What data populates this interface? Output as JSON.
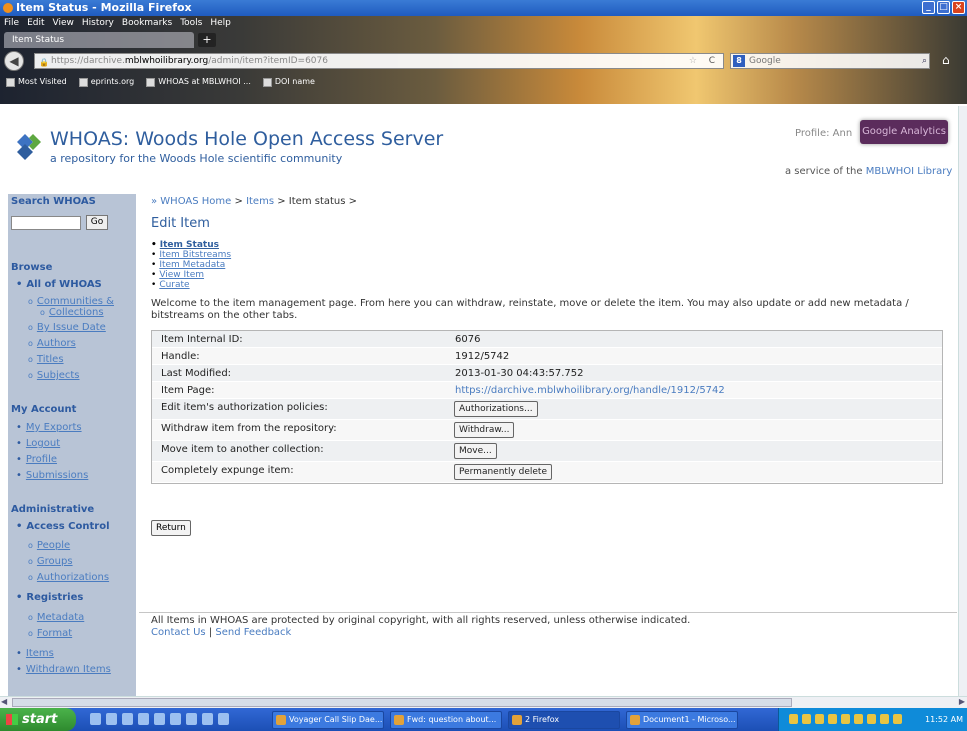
{
  "window": {
    "title": "Item Status - Mozilla Firefox"
  },
  "menubar": [
    "File",
    "Edit",
    "View",
    "History",
    "Bookmarks",
    "Tools",
    "Help"
  ],
  "browser": {
    "tab_title": "Item Status",
    "url_prefix": "https://darchive.",
    "url_host": "mblwhoilibrary.org",
    "url_path": "/admin/item?itemID=6076",
    "search_placeholder": "Google",
    "bookmarks": [
      "Most Visited",
      "eprints.org",
      "WHOAS at MBLWHOI ...",
      "DOI name"
    ]
  },
  "header": {
    "title": "WHOAS: Woods Hole Open Access Server",
    "subtitle": "a repository for the Woods Hole scientific community",
    "profile_label": "Profile: Ann",
    "analytics_button": "Google Analytics",
    "service_prefix": "a service of the ",
    "service_link": "MBLWHOI Library"
  },
  "sidebar": {
    "search_heading": "Search WHOAS",
    "go_label": "Go",
    "browse_heading": "Browse",
    "all_of": "All of WHOAS",
    "browse_items": [
      "Communities &",
      "Collections",
      "By Issue Date",
      "Authors",
      "Titles",
      "Subjects"
    ],
    "account_heading": "My Account",
    "account_items": [
      "My Exports",
      "Logout",
      "Profile",
      "Submissions"
    ],
    "admin_heading": "Administrative",
    "access_control": "Access Control",
    "access_items": [
      "People",
      "Groups",
      "Authorizations"
    ],
    "registries": "Registries",
    "registry_items": [
      "Metadata",
      "Format"
    ],
    "more_items": [
      "Items",
      "Withdrawn Items"
    ]
  },
  "main": {
    "breadcrumb_home": "WHOAS Home",
    "breadcrumb_items": "Items",
    "breadcrumb_current": "Item status",
    "heading": "Edit Item",
    "tabs": [
      "Item Status",
      "Item Bitstreams",
      "Item Metadata",
      "View Item",
      "Curate"
    ],
    "welcome": "Welcome to the item management page. From here you can withdraw, reinstate, move or delete the item. You may also update or add new metadata / bitstreams on the other tabs.",
    "rows": [
      {
        "label": "Item Internal ID:",
        "value": "6076"
      },
      {
        "label": "Handle:",
        "value": "1912/5742"
      },
      {
        "label": "Last Modified:",
        "value": "2013-01-30 04:43:57.752"
      },
      {
        "label": "Item Page:",
        "value": "https://darchive.mblwhoilibrary.org/handle/1912/5742"
      }
    ],
    "actions": [
      {
        "label": "Edit item's authorization policies:",
        "button": "Authorizations..."
      },
      {
        "label": "Withdraw item from the repository:",
        "button": "Withdraw..."
      },
      {
        "label": "Move item to another collection:",
        "button": "Move..."
      },
      {
        "label": "Completely expunge item:",
        "button": "Permanently delete"
      }
    ],
    "return_label": "Return"
  },
  "footer": {
    "notice": "All Items in WHOAS are protected by original copyright, with all rights reserved, unless otherwise indicated.",
    "contact": "Contact Us",
    "feedback": "Send Feedback"
  },
  "taskbar": {
    "start": "start",
    "tasks": [
      "Voyager Call Slip Dae...",
      "Fwd: question about...",
      "2 Firefox",
      "Document1 - Microso..."
    ],
    "clock": "11:52 AM"
  },
  "colors": {
    "link": "#4a7cc0",
    "heading": "#2f5e9e",
    "sidebar_bg": "#b8c4d6",
    "analytics_bg": "#5b2c5c"
  }
}
